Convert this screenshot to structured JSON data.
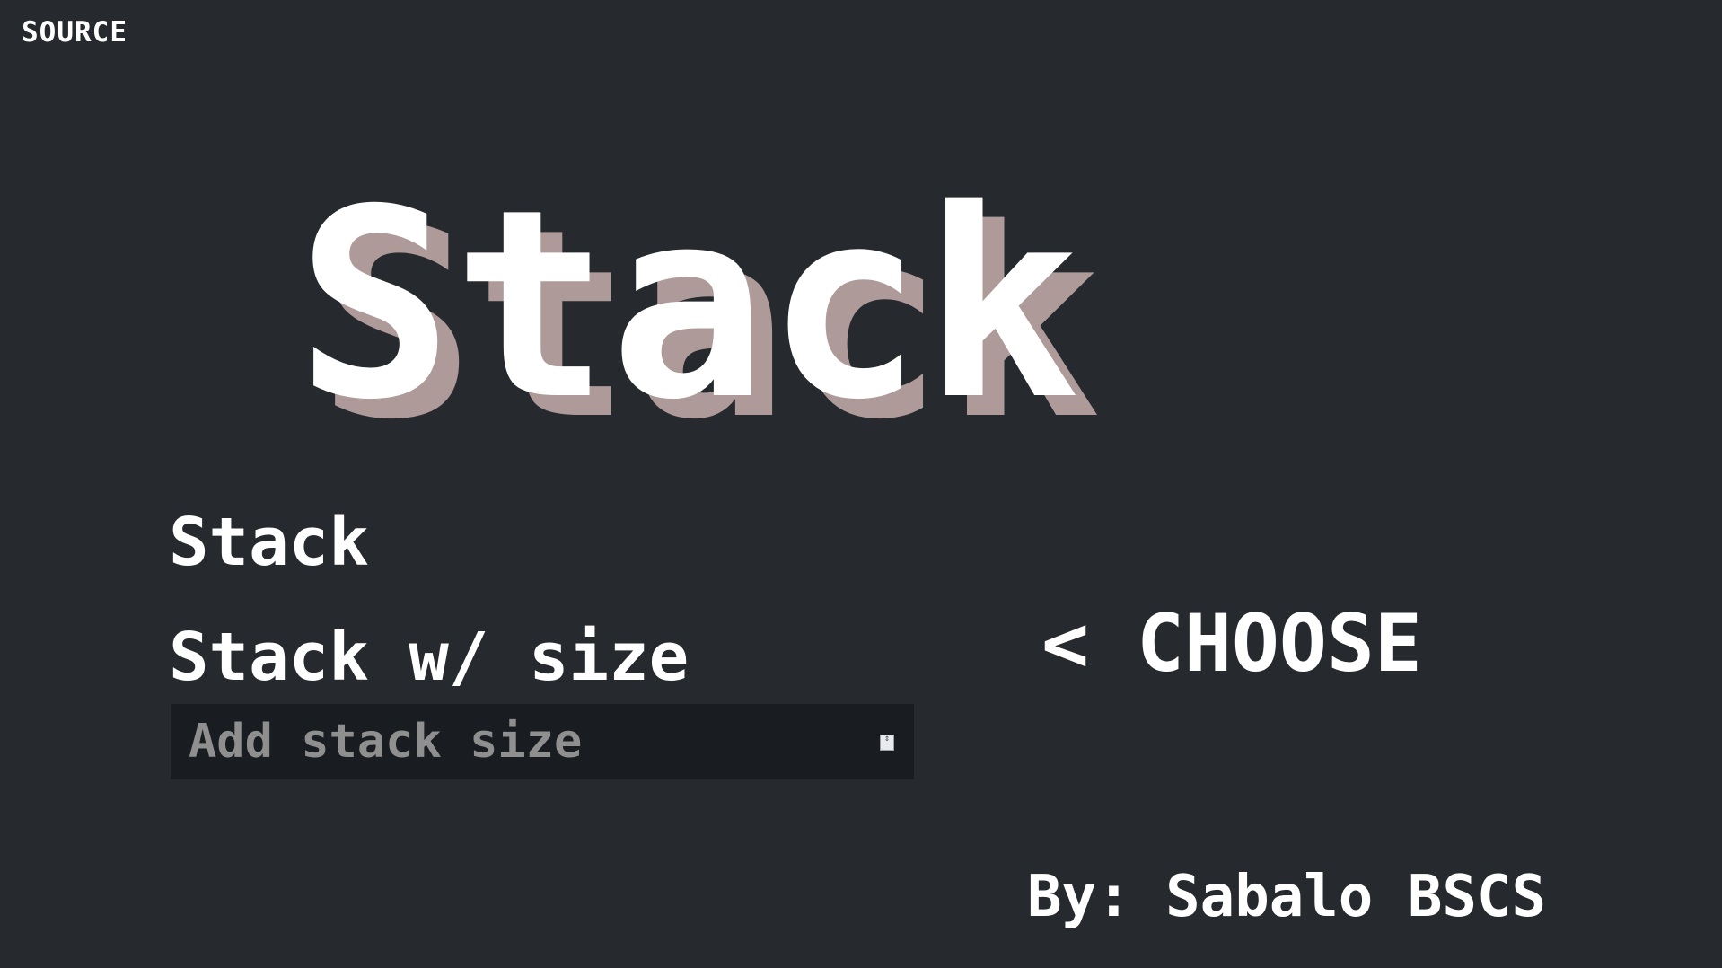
{
  "header": {
    "source_link": "SOURCE"
  },
  "hero": {
    "title": "Stack"
  },
  "options": [
    {
      "label": "Stack"
    },
    {
      "label": "Stack w/ size"
    }
  ],
  "size_input": {
    "placeholder": "Add stack size",
    "value": ""
  },
  "choose_hint": "< CHOOSE",
  "footer": {
    "author": "By: Sabalo BSCS"
  },
  "colors": {
    "background": "#26292d",
    "text": "#ffffff",
    "title_shadow": "#ae9a99",
    "input_background": "#191c21",
    "placeholder": "#8f8f8f"
  }
}
